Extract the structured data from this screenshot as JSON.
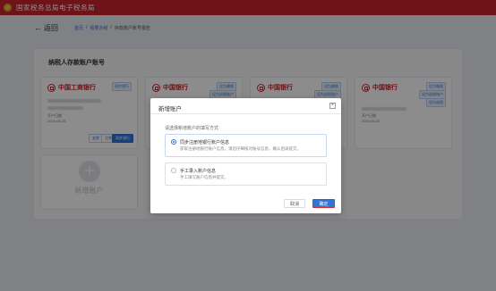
{
  "app": {
    "title": "国家税务总局电子税务局"
  },
  "nav": {
    "back_label": "返回",
    "breadcrumb": [
      "首页",
      "我要办税",
      "存款账户账号报告"
    ]
  },
  "section": {
    "title": "纳税人存款账户账号"
  },
  "cards": [
    {
      "bank": "中国工商银行",
      "tags": [
        "同步银行"
      ],
      "buttons": [
        "变更",
        "注销",
        "同步银行"
      ]
    },
    {
      "bank": "中国银行",
      "tags": [
        "设为缴税",
        "设为退税账户"
      ],
      "buttons": []
    },
    {
      "bank": "中国银行",
      "tags": [
        "设为缴税",
        "设为退税账户"
      ],
      "buttons": []
    },
    {
      "bank": "中国银行",
      "tags": [
        "设为缴税",
        "设为退税账户",
        "设为退税"
      ],
      "buttons": []
    }
  ],
  "card_meta": {
    "label": "开户日期",
    "date": "2022-05-25"
  },
  "add_card": {
    "label": "新增账户"
  },
  "dialog": {
    "title": "新增账户",
    "prompt": "请选择新增账户的填写方式",
    "options": [
      {
        "title": "同步注册地银行账户信息",
        "desc": "获取注册地银行账户信息，请您仔细核对账号信息，确认后再提交。",
        "selected": true
      },
      {
        "title": "手工录入账户信息",
        "desc": "手工填写账户信息并提交。",
        "selected": false
      }
    ],
    "cancel": "取消",
    "confirm": "确定"
  },
  "colors": {
    "brand_red": "#c8242a",
    "accent_blue": "#2f74d8"
  }
}
